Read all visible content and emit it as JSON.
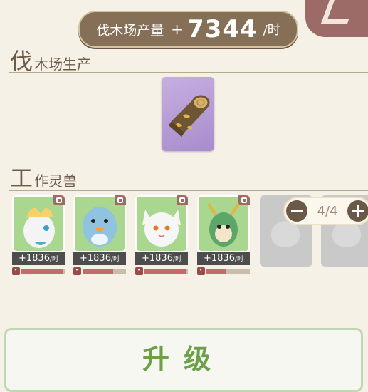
{
  "header": {
    "output_label": "伐木场产量",
    "output_sign": "+",
    "output_value": "7344",
    "output_unit": "/时"
  },
  "production_section": {
    "title_big": "伐",
    "title_rest": "木场生产"
  },
  "worker_section": {
    "title_big": "工",
    "title_rest": "作灵兽"
  },
  "pets": [
    {
      "rate": "+1836",
      "unit": "/时",
      "time_remaining_fraction": 0.95
    },
    {
      "rate": "+1836",
      "unit": "/时",
      "time_remaining_fraction": 0.7
    },
    {
      "rate": "+1836",
      "unit": "/时",
      "time_remaining_fraction": 0.95
    },
    {
      "rate": "+1836",
      "unit": "/时",
      "time_remaining_fraction": 0.45
    }
  ],
  "worker_counter": "4/4",
  "upgrade_button": "升级",
  "colors": {
    "accent_brown": "#866f57",
    "upgrade_green": "#6ea04a",
    "pet_bg": "#a9d78f",
    "progress_fill": "#c46a6a"
  }
}
